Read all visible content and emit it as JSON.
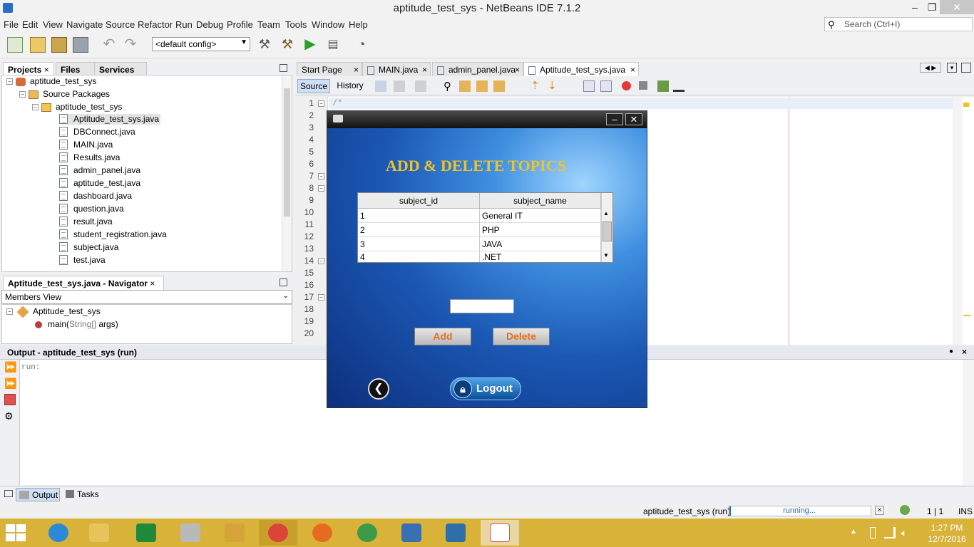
{
  "window": {
    "title": "aptitude_test_sys - NetBeans IDE 7.1.2",
    "min": "–",
    "max": "❐",
    "close": "✕"
  },
  "menu": [
    "File",
    "Edit",
    "View",
    "Navigate",
    "Source",
    "Refactor",
    "Run",
    "Debug",
    "Profile",
    "Team",
    "Tools",
    "Window",
    "Help"
  ],
  "search": {
    "placeholder": "Search (Ctrl+I)"
  },
  "toolbar": {
    "config": "<default config>"
  },
  "projects_panel": {
    "tabs": [
      "Projects",
      "Files",
      "Services"
    ],
    "tree": {
      "project": "aptitude_test_sys",
      "source_packages": "Source Packages",
      "package": "aptitude_test_sys",
      "files": [
        "Aptitude_test_sys.java",
        "DBConnect.java",
        "MAIN.java",
        "Results.java",
        "admin_panel.java",
        "aptitude_test.java",
        "dashboard.java",
        "question.java",
        "result.java",
        "student_registration.java",
        "subject.java",
        "test.java"
      ]
    }
  },
  "navigator": {
    "title": "Aptitude_test_sys.java - Navigator",
    "view": "Members View",
    "class": "Aptitude_test_sys",
    "method_name": "main(",
    "method_param": "String[]",
    "method_rest": " args)"
  },
  "editor": {
    "tabs": [
      "Start Page",
      "MAIN.java",
      "admin_panel.java",
      "Aptitude_test_sys.java"
    ],
    "source_tab": "Source",
    "history_tab": "History",
    "line_numbers": [
      "1",
      "2",
      "3",
      "4",
      "5",
      "6",
      "7",
      "8",
      "9",
      "10",
      "11",
      "12",
      "13",
      "14",
      "15",
      "16",
      "17",
      "18",
      "19",
      "20"
    ],
    "first_line": "/*"
  },
  "dialog": {
    "heading": "ADD & DELETE TOPICS",
    "columns": [
      "subject_id",
      "subject_name"
    ],
    "rows": [
      [
        "1",
        "General IT"
      ],
      [
        "2",
        "PHP"
      ],
      [
        "3",
        "JAVA"
      ],
      [
        "4",
        ".NET"
      ]
    ],
    "add_label": "Add",
    "delete_label": "Delete",
    "logout_label": "Logout"
  },
  "output": {
    "title": "Output - aptitude_test_sys (run)",
    "text": "run:",
    "bottom_tabs": [
      "Output",
      "Tasks"
    ]
  },
  "status": {
    "project": "aptitude_test_sys (run)",
    "progress": "running...",
    "position": "1 | 1",
    "mode": "INS"
  },
  "taskbar": {
    "time": "1:27 PM",
    "date": "12/7/2016",
    "accent": "#d9b23a"
  }
}
